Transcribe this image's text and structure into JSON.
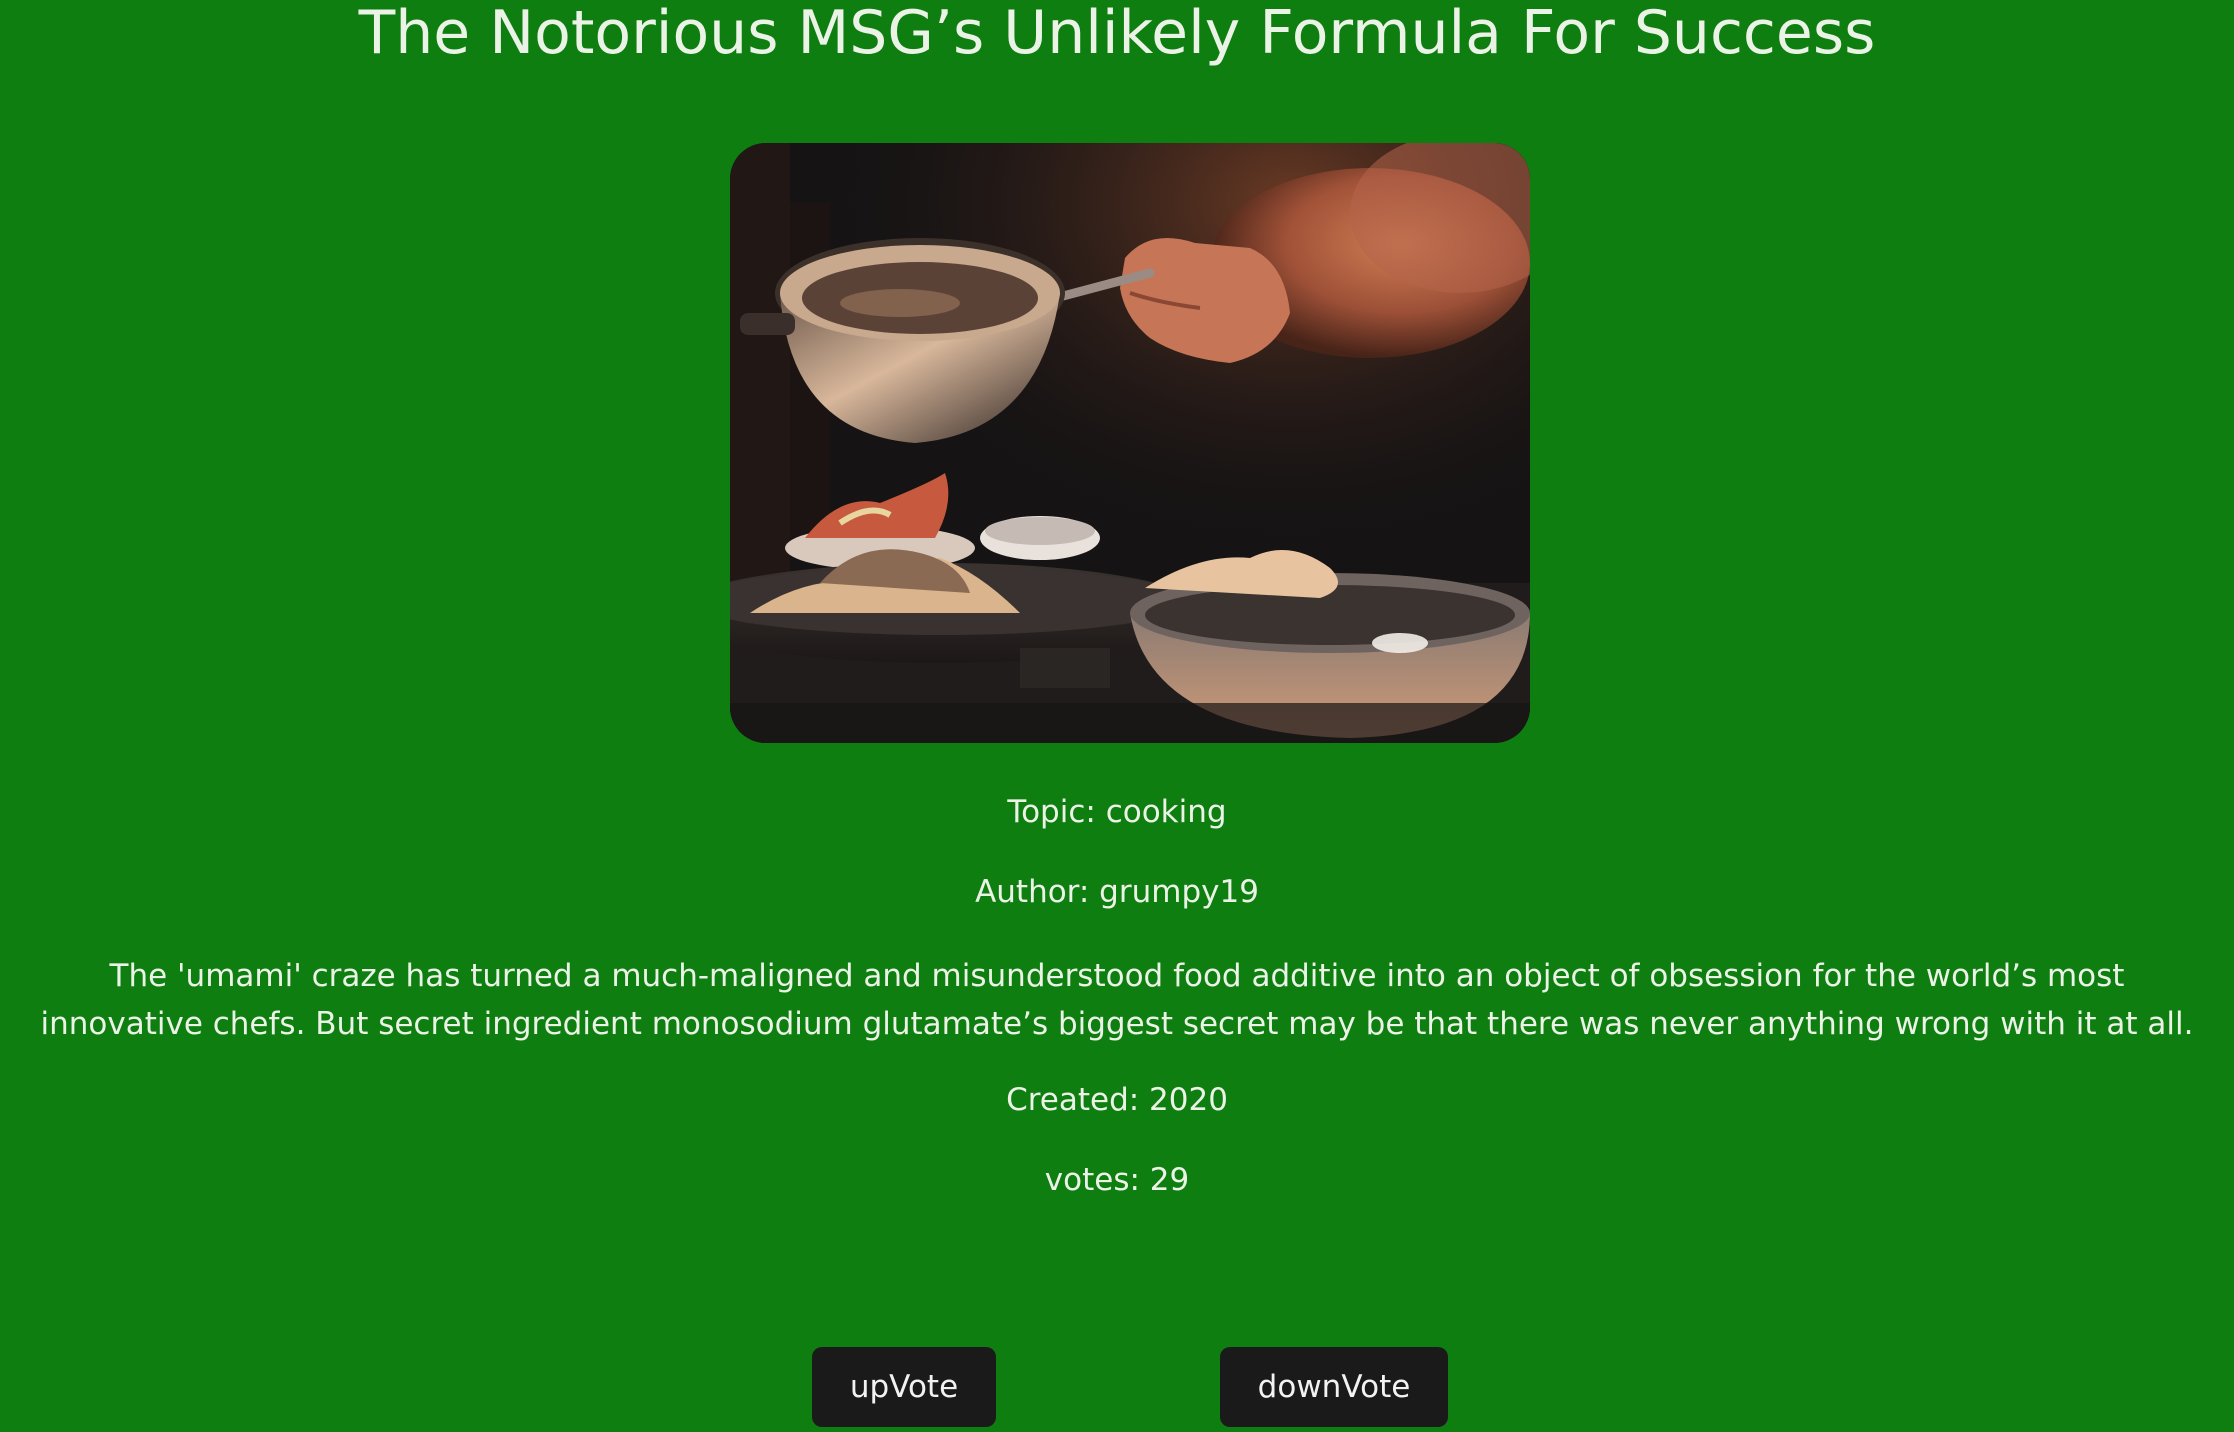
{
  "article": {
    "title": "The Notorious MSG’s Unlikely Formula For Success",
    "topic": "Topic: cooking",
    "author": "Author: grumpy19",
    "description": "The 'umami' craze has turned a much-maligned and misunderstood food additive into an object of obsession for the world’s most innovative chefs. But secret ingredient monosodium glutamate’s biggest secret may be that there was never anything wrong with it at all.",
    "created": "Created: 2020",
    "votes": "votes: 29"
  },
  "actions": {
    "upvote_label": "upVote",
    "downvote_label": "downVote"
  },
  "colors": {
    "background": "#0f7e11",
    "text": "#eaf3e6",
    "button": "#1b1a1b"
  }
}
